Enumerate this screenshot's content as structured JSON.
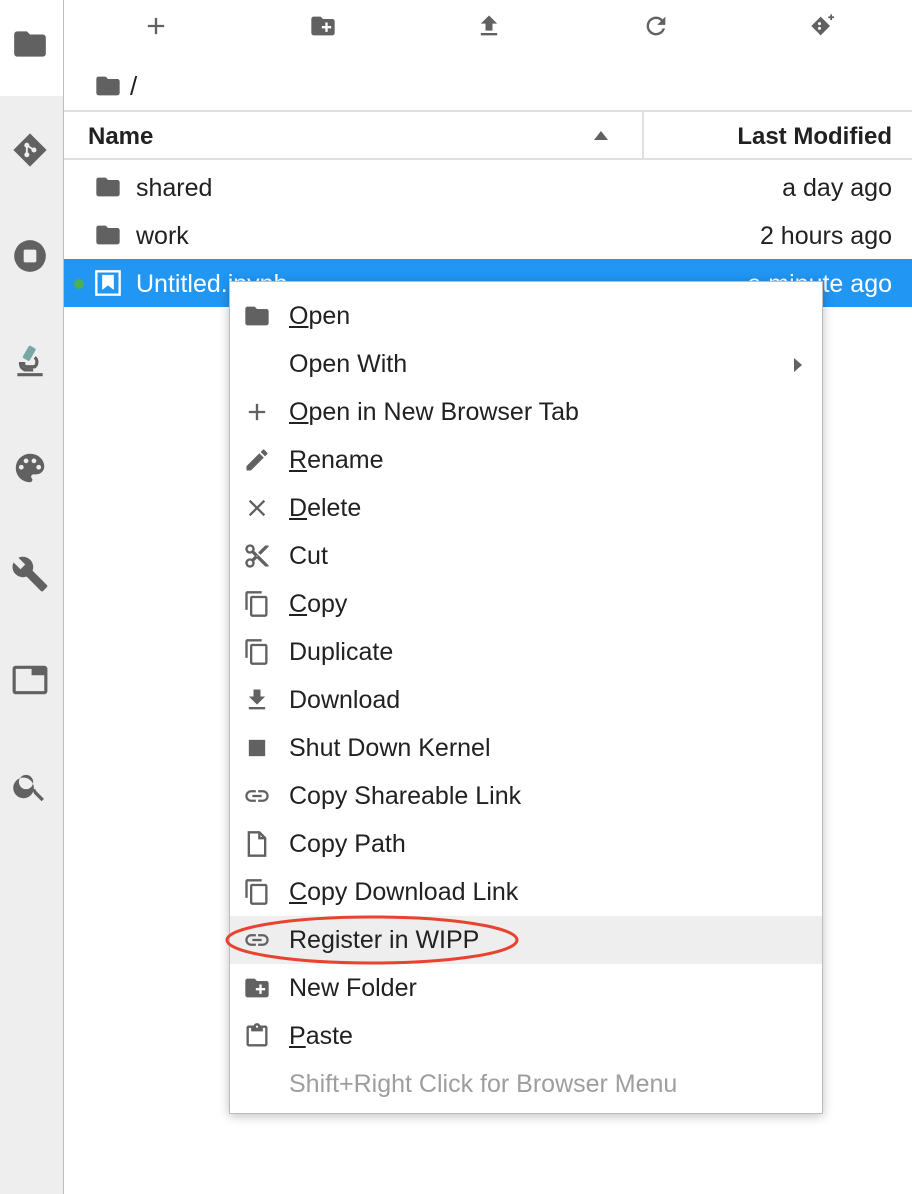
{
  "sidebar": {
    "icons": [
      "folder-icon",
      "git-icon",
      "stop-circle-icon",
      "microscope-icon",
      "palette-icon",
      "wrench-icon",
      "tab-window-icon",
      "search-icon"
    ]
  },
  "toolbar": {
    "buttons": [
      "new-launcher-icon",
      "new-folder-icon",
      "upload-icon",
      "refresh-icon",
      "git-clone-icon"
    ]
  },
  "breadcrumb": {
    "path": "/"
  },
  "listing": {
    "columns": {
      "name": "Name",
      "modified": "Last Modified"
    },
    "files": [
      {
        "name": "shared",
        "modified": "a day ago",
        "type": "folder"
      },
      {
        "name": "work",
        "modified": "2 hours ago",
        "type": "folder"
      },
      {
        "name": "Untitled.ipynb",
        "modified": "a minute ago",
        "type": "notebook",
        "selected": true,
        "running": true
      }
    ]
  },
  "context_menu": {
    "items": [
      {
        "label": "Open",
        "underline": "O",
        "icon": "folder-icon"
      },
      {
        "label": "Open With",
        "submenu": true
      },
      {
        "label": "Open in New Browser Tab",
        "underline": "O",
        "icon": "plus-icon"
      },
      {
        "label": "Rename",
        "underline": "R",
        "icon": "pencil-icon"
      },
      {
        "label": "Delete",
        "underline": "D",
        "icon": "close-icon"
      },
      {
        "label": "Cut",
        "icon": "scissors-icon"
      },
      {
        "label": "Copy",
        "underline": "C",
        "icon": "copy-icon"
      },
      {
        "label": "Duplicate",
        "icon": "copy-icon"
      },
      {
        "label": "Download",
        "icon": "download-icon"
      },
      {
        "label": "Shut Down Kernel",
        "icon": "stop-icon"
      },
      {
        "label": "Copy Shareable Link",
        "icon": "link-icon"
      },
      {
        "label": "Copy Path",
        "icon": "file-icon"
      },
      {
        "label": "Copy Download Link",
        "underline": "C",
        "icon": "copy-icon"
      },
      {
        "label": "Register in WIPP",
        "icon": "link-icon",
        "highlighted": true
      },
      {
        "label": "New Folder",
        "icon": "new-folder-icon"
      },
      {
        "label": "Paste",
        "underline": "P",
        "icon": "clipboard-icon"
      },
      {
        "label": "Shift+Right Click for Browser Menu",
        "disabled": true
      }
    ]
  },
  "colors": {
    "selection": "#2196f3",
    "running_dot": "#4caf50",
    "annotation": "#e8432e"
  }
}
